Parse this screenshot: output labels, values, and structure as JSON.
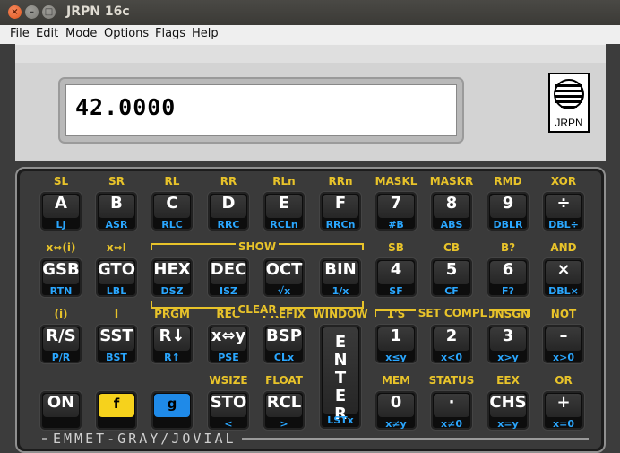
{
  "window": {
    "title": "JRPN 16c",
    "close_icon": "×",
    "minimize_icon": "–",
    "maximize_icon": "□"
  },
  "menu": [
    "File",
    "Edit",
    "Mode",
    "Options",
    "Flags",
    "Help"
  ],
  "display": {
    "value": "42.0000"
  },
  "logo": {
    "text": "JRPN",
    "icon": "globe-logo"
  },
  "brand": "EMMET-GRAY/JOVIAL",
  "brackets": {
    "show": "SHOW",
    "clear": "CLEAR",
    "set_compl": "SET COMPL"
  },
  "rows": [
    [
      {
        "f": "SL",
        "m": "A",
        "g": "LJ"
      },
      {
        "f": "SR",
        "m": "B",
        "g": "ASR"
      },
      {
        "f": "RL",
        "m": "C",
        "g": "RLC"
      },
      {
        "f": "RR",
        "m": "D",
        "g": "RRC"
      },
      {
        "f": "RLn",
        "m": "E",
        "g": "RCLn"
      },
      {
        "f": "RRn",
        "m": "F",
        "g": "RRCn"
      },
      {
        "f": "MASKL",
        "m": "7",
        "g": "#B"
      },
      {
        "f": "MASKR",
        "m": "8",
        "g": "ABS"
      },
      {
        "f": "RMD",
        "m": "9",
        "g": "DBLR"
      },
      {
        "f": "XOR",
        "m": "÷",
        "g": "DBL÷"
      }
    ],
    [
      {
        "f": "x⇔(i)",
        "m": "GSB",
        "g": "RTN"
      },
      {
        "f": "x⇔I",
        "m": "GTO",
        "g": "LBL"
      },
      {
        "f": "",
        "m": "HEX",
        "g": "DSZ"
      },
      {
        "f": "",
        "m": "DEC",
        "g": "ISZ"
      },
      {
        "f": "",
        "m": "OCT",
        "g": "√x"
      },
      {
        "f": "",
        "m": "BIN",
        "g": "1/x"
      },
      {
        "f": "SB",
        "m": "4",
        "g": "SF"
      },
      {
        "f": "CB",
        "m": "5",
        "g": "CF"
      },
      {
        "f": "B?",
        "m": "6",
        "g": "F?"
      },
      {
        "f": "AND",
        "m": "×",
        "g": "DBL×"
      }
    ],
    [
      {
        "f": "(i)",
        "m": "R/S",
        "g": "P/R"
      },
      {
        "f": "I",
        "m": "SST",
        "g": "BST"
      },
      {
        "f": "PRGM",
        "m": "R↓",
        "g": "R↑"
      },
      {
        "f": "REG",
        "m": "x⇔y",
        "g": "PSE"
      },
      {
        "f": "PREFIX",
        "m": "BSP",
        "g": "CLx"
      },
      {
        "f": "WINDOW",
        "m": "ENTER",
        "g": "LSTx"
      },
      {
        "f": "1'S",
        "m": "1",
        "g": "x≤y"
      },
      {
        "f": "2'S",
        "m": "2",
        "g": "x<0"
      },
      {
        "f": "UNSGN",
        "m": "3",
        "g": "x>y"
      },
      {
        "f": "NOT",
        "m": "–",
        "g": "x>0"
      }
    ],
    [
      {
        "f": "",
        "m": "ON",
        "g": ""
      },
      {
        "f": "",
        "m": "f",
        "g": ""
      },
      {
        "f": "",
        "m": "g",
        "g": ""
      },
      {
        "f": "WSIZE",
        "m": "STO",
        "g": "<"
      },
      {
        "f": "FLOAT",
        "m": "RCL",
        "g": ">"
      },
      {
        "f": "MEM",
        "m": "0",
        "g": "x≠y"
      },
      {
        "f": "STATUS",
        "m": "·",
        "g": "x≠0"
      },
      {
        "f": "EEX",
        "m": "CHS",
        "g": "x=y"
      },
      {
        "f": "OR",
        "m": "+",
        "g": "x=0"
      }
    ],
    []
  ],
  "colors": {
    "f_yellow": "#f6d21c",
    "g_blue": "#1f8ae8",
    "label_gold": "#e8c32a",
    "label_blue": "#2aa7ff"
  }
}
